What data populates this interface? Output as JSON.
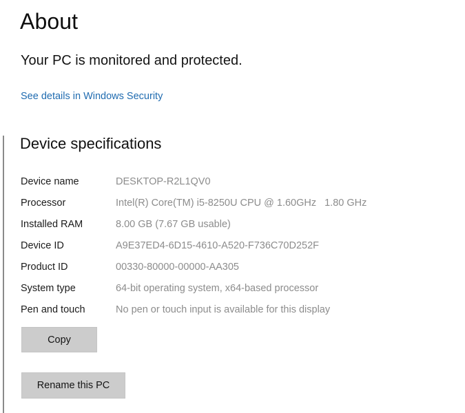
{
  "page": {
    "title": "About",
    "protection_status": "Your PC is monitored and protected.",
    "security_link": "See details in Windows Security",
    "section_heading": "Device specifications"
  },
  "specs": {
    "rows": [
      {
        "label": "Device name",
        "value": "DESKTOP-R2L1QV0"
      },
      {
        "label": "Processor",
        "value_part1": "Intel(R) Core(TM) i5-8250U CPU @ 1.60GHz",
        "value_part2": "1.80 GHz"
      },
      {
        "label": "Installed RAM",
        "value": "8.00 GB (7.67 GB usable)"
      },
      {
        "label": "Device ID",
        "value": "A9E37ED4-6D15-4610-A520-F736C70D252F"
      },
      {
        "label": "Product ID",
        "value": "00330-80000-00000-AA305"
      },
      {
        "label": "System type",
        "value": "64-bit operating system, x64-based processor"
      },
      {
        "label": "Pen and touch",
        "value": "No pen or touch input is available for this display"
      }
    ]
  },
  "buttons": {
    "copy": "Copy",
    "rename": "Rename this PC"
  },
  "colors": {
    "background": "#ffffff",
    "link": "#1f6bb0",
    "label_text": "#1b1b1b",
    "value_text": "#8c8c8c",
    "button_face": "#cccccc",
    "scroll_rail": "#8a8a8a"
  }
}
